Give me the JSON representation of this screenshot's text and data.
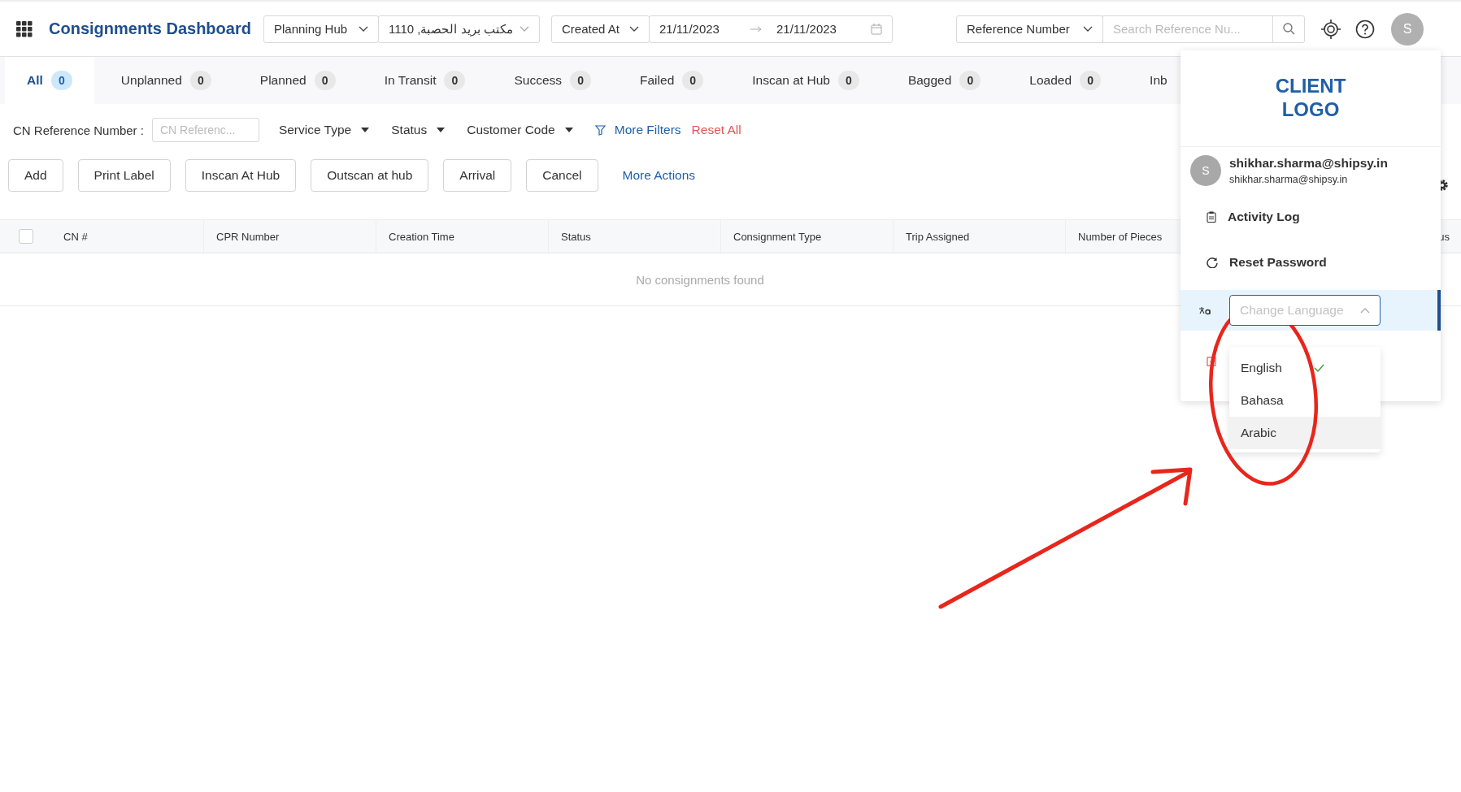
{
  "header": {
    "title": "Consignments Dashboard",
    "hub_type": "Planning Hub",
    "hub": "مكتب بريد الحصبة, 1110",
    "date_field": "Created At",
    "date_from": "21/11/2023",
    "date_to": "21/11/2023",
    "search_type": "Reference Number",
    "search": {
      "placeholder": "Search Reference Nu..."
    },
    "avatar": "S"
  },
  "tabs": [
    {
      "label": "All",
      "count": "0",
      "selected": true
    },
    {
      "label": "Unplanned",
      "count": "0",
      "selected": false
    },
    {
      "label": "Planned",
      "count": "0",
      "selected": false
    },
    {
      "label": "In Transit",
      "count": "0",
      "selected": false
    },
    {
      "label": "Success",
      "count": "0",
      "selected": false
    },
    {
      "label": "Failed",
      "count": "0",
      "selected": false
    },
    {
      "label": "Inscan at Hub",
      "count": "0",
      "selected": false
    },
    {
      "label": "Bagged",
      "count": "0",
      "selected": false
    },
    {
      "label": "Loaded",
      "count": "0",
      "selected": false
    },
    {
      "label": "Inb",
      "selected": false
    }
  ],
  "filters": {
    "cn_label": "CN Reference Number :",
    "cn_field": {
      "placeholder": "CN Referenc..."
    },
    "dropdowns": [
      "Service Type",
      "Status",
      "Customer Code"
    ],
    "more_filters": "More Filters",
    "reset": "Reset All"
  },
  "actions": {
    "buttons": [
      "Add",
      "Print Label",
      "Inscan At Hub",
      "Outscan at hub",
      "Arrival",
      "Cancel"
    ],
    "more": "More Actions"
  },
  "table": {
    "select_all": {
      "checked": false
    },
    "columns": [
      {
        "label": "CN #",
        "kind": "full"
      },
      {
        "label": "CPR Number",
        "kind": "full"
      },
      {
        "label": "Creation Time",
        "kind": "full"
      },
      {
        "label": "Status",
        "kind": "full"
      },
      {
        "label": "Consignment Type",
        "kind": "full"
      },
      {
        "label": "Trip Assigned",
        "kind": "full"
      },
      {
        "label": "Number of Pieces",
        "kind": "full"
      },
      {
        "label": "us",
        "kind": "cut"
      }
    ],
    "empty_text": "No consignments found"
  },
  "user_menu": {
    "logo": "CLIENT LOGO",
    "avatar": "S",
    "name": "shikhar.sharma@shipsy.in",
    "email": "shikhar.sharma@shipsy.in",
    "items": [
      {
        "kind": "activity",
        "label": "Activity Log"
      },
      {
        "kind": "reset",
        "label": "Reset Password"
      }
    ],
    "language": {
      "placeholder": "Change Language",
      "expanded": true,
      "options": [
        {
          "label": "English",
          "selected": true,
          "hovered": false
        },
        {
          "label": "Bahasa",
          "selected": false,
          "hovered": false
        },
        {
          "label": "Arabic",
          "selected": false,
          "hovered": true
        }
      ]
    }
  }
}
